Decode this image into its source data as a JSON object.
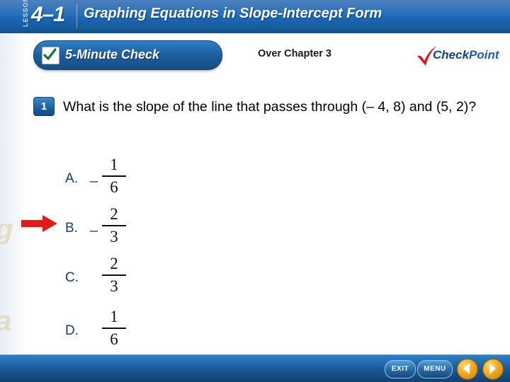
{
  "banner": {
    "lesson_word": "LESSON",
    "lesson_number": "4–1",
    "title": "Graphing Equations in Slope-Intercept Form"
  },
  "header": {
    "check_label": "5-Minute Check",
    "over_chapter": "Over Chapter 3",
    "checkpoint_check": "Check",
    "checkpoint_point": "Point",
    "check_icon": "checkmark-icon",
    "checkpoint_icon": "checkmark-icon"
  },
  "question": {
    "number": "1",
    "text": "What is the slope of the line that passes through (– 4, 8) and (5, 2)?"
  },
  "choices": [
    {
      "letter": "A.",
      "sign": "–",
      "numerator": "1",
      "denominator": "6",
      "selected": false
    },
    {
      "letter": "B.",
      "sign": "–",
      "numerator": "2",
      "denominator": "3",
      "selected": true
    },
    {
      "letter": "C.",
      "sign": "",
      "numerator": "2",
      "denominator": "3",
      "selected": false
    },
    {
      "letter": "D.",
      "sign": "",
      "numerator": "1",
      "denominator": "6",
      "selected": false
    }
  ],
  "pointer": {
    "icon": "right-arrow-icon",
    "color": "#e01b1b",
    "points_to": "B."
  },
  "footer": {
    "exit_label": "EXIT",
    "menu_label": "MENU",
    "prev_icon": "left-triangle-icon",
    "next_icon": "right-triangle-icon"
  },
  "colors": {
    "banner_blue": "#1d5e9e",
    "accent_gold": "#f0a921",
    "answer_text": "#1b3b6f",
    "arrow_red": "#e01b1b"
  }
}
